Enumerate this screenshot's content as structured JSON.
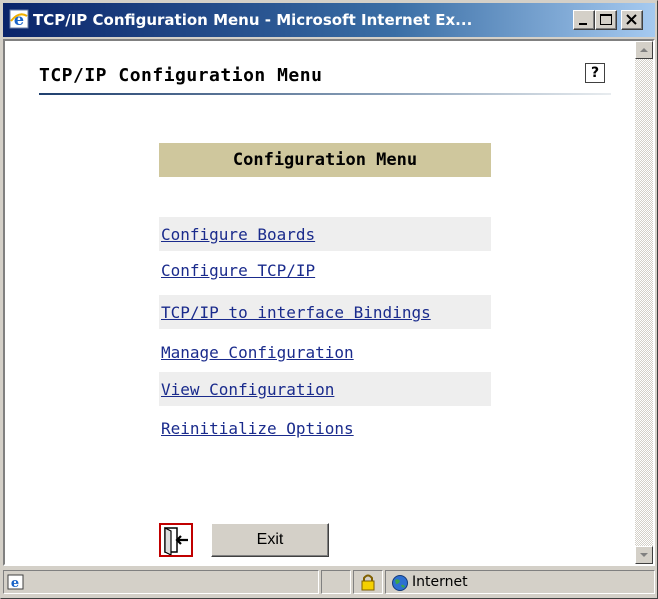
{
  "window": {
    "title": "TCP/IP Configuration Menu - Microsoft Internet Ex...",
    "title_icon": "ie-icon",
    "controls": [
      "minimize-icon",
      "maximize-icon",
      "close-icon"
    ]
  },
  "page": {
    "title": "TCP/IP Configuration Menu",
    "help_label": "?"
  },
  "menu": {
    "header": "Configuration Menu",
    "items": [
      {
        "label": "Configure Boards",
        "shaded": true
      },
      {
        "label": "Configure TCP/IP",
        "shaded": false
      },
      {
        "label": "TCP/IP to interface Bindings",
        "shaded": true
      },
      {
        "label": "Manage Configuration",
        "shaded": false
      },
      {
        "label": "View Configuration",
        "shaded": true
      },
      {
        "label": "Reinitialize Options",
        "shaded": false
      }
    ]
  },
  "exit": {
    "label": "Exit",
    "icon": "exit-door-icon"
  },
  "statusbar": {
    "zone": "Internet",
    "icons": [
      "ie-page-icon",
      "lock-icon",
      "globe-icon"
    ]
  },
  "colors": {
    "titlebar_start": "#0a246a",
    "titlebar_end": "#a6caf0",
    "menu_header_bg": "#cfc79d",
    "link": "#1a2b8c",
    "row_shade": "#eeeeee"
  }
}
